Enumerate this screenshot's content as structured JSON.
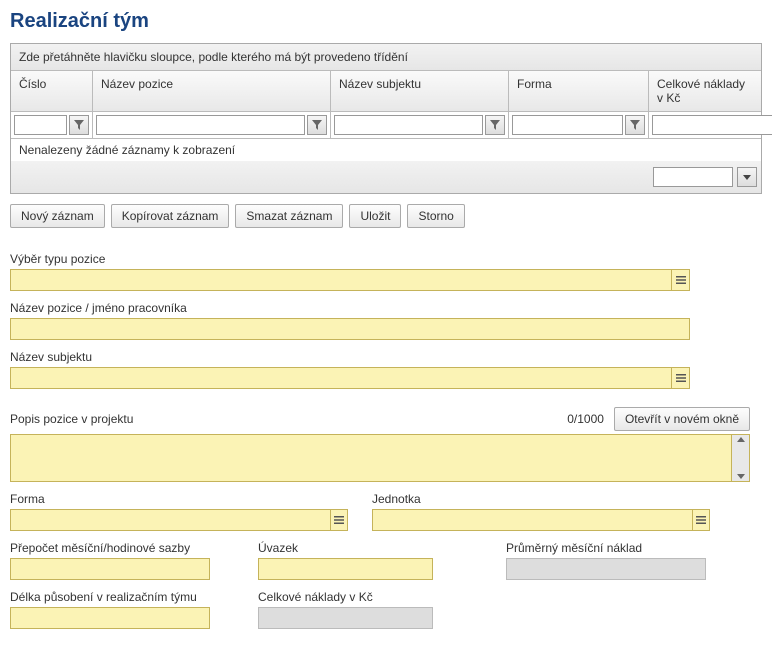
{
  "page_title": "Realizační tým",
  "grid": {
    "group_hint": "Zde přetáhněte hlavičku sloupce, podle kterého má být provedeno třídění",
    "columns": {
      "c1": "Číslo",
      "c2": "Název pozice",
      "c3": "Název subjektu",
      "c4": "Forma",
      "c5": "Celkové náklady v Kč"
    },
    "empty": "Nenalezeny žádné záznamy k zobrazení"
  },
  "toolbar": {
    "new": "Nový záznam",
    "copy": "Kopírovat záznam",
    "delete": "Smazat záznam",
    "save": "Uložit",
    "cancel": "Storno"
  },
  "form": {
    "position_type": "Výběr typu pozice",
    "position_name": "Název pozice / jméno pracovníka",
    "subject_name": "Název subjektu",
    "desc": {
      "label": "Popis pozice v projektu",
      "counter": "0/1000",
      "open_btn": "Otevřít v novém okně"
    },
    "forma": "Forma",
    "unit": "Jednotka",
    "rate": "Přepočet měsíční/hodinové sazby",
    "workload": "Úvazek",
    "avg_cost": "Průměrný měsíční náklad",
    "duration": "Délka působení v realizačním týmu",
    "total_cost": "Celkové náklady v Kč"
  }
}
